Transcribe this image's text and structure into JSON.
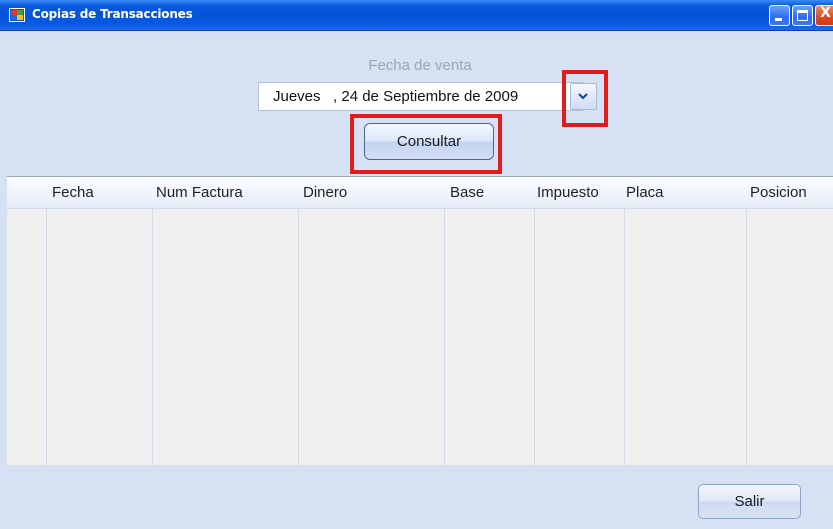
{
  "window": {
    "title": "Copias de Transacciones",
    "buttons": {
      "minimize": "minimize",
      "maximize": "maximize",
      "close": "X"
    }
  },
  "date_picker": {
    "label": "Fecha de venta",
    "value": "Jueves   , 24 de Septiembre de 2009",
    "dropdown_icon": "chevron-down-icon"
  },
  "actions": {
    "consultar_label": "Consultar",
    "salir_label": "Salir"
  },
  "table": {
    "columns": [
      "Fecha",
      "Num Factura",
      "Dinero",
      "Base",
      "Impuesto",
      "Placa",
      "Posicion"
    ],
    "rows": []
  },
  "highlights": [
    "date-dropdown-button",
    "consultar-button"
  ],
  "colors": {
    "titlebar": "#0454d8",
    "window_bg": "#d6e2f3",
    "highlight": "#e21b1b",
    "grid_bg": "#f0f0f0",
    "label_muted": "#9aa6b6"
  }
}
